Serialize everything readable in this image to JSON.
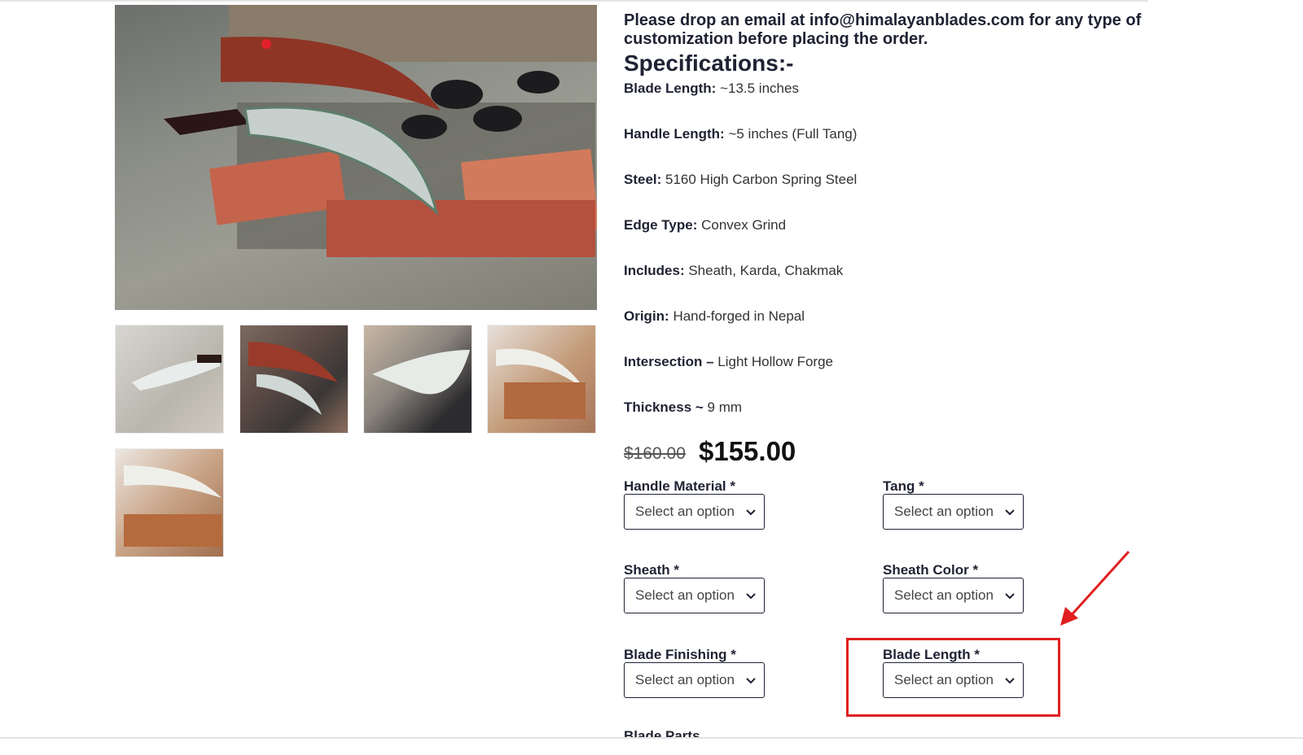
{
  "notice": "Please drop an email at info@himalayanblades.com for any type of customization before placing the order.",
  "specifications": {
    "heading": "Specifications:-",
    "items": [
      {
        "label": "Blade Length:",
        "value": " ~13.5 inches"
      },
      {
        "label": "Handle Length:",
        "value": " ~5 inches (Full Tang)"
      },
      {
        "label": "Steel:",
        "value": " 5160 High Carbon Spring Steel"
      },
      {
        "label": "Edge Type:",
        "value": " Convex Grind"
      },
      {
        "label": "Includes:",
        "value": " Sheath, Karda, Chakmak"
      },
      {
        "label": "Origin:",
        "value": " Hand-forged in Nepal"
      },
      {
        "label": "Intersection –",
        "value": " Light Hollow Forge"
      },
      {
        "label": "Thickness ~",
        "value": " 9 mm"
      }
    ]
  },
  "price": {
    "old": "$160.00",
    "current": "$155.00"
  },
  "options": [
    {
      "label": "Handle Material *",
      "value": "Select an option"
    },
    {
      "label": "Tang *",
      "value": "Select an option"
    },
    {
      "label": "Sheath *",
      "value": "Select an option"
    },
    {
      "label": "Sheath Color *",
      "value": "Select an option"
    },
    {
      "label": "Blade Finishing *",
      "value": "Select an option"
    },
    {
      "label": "Blade Length *",
      "value": "Select an option"
    }
  ],
  "next_option_label": "Blade Parts",
  "annotation": {
    "color": "#e02020"
  }
}
